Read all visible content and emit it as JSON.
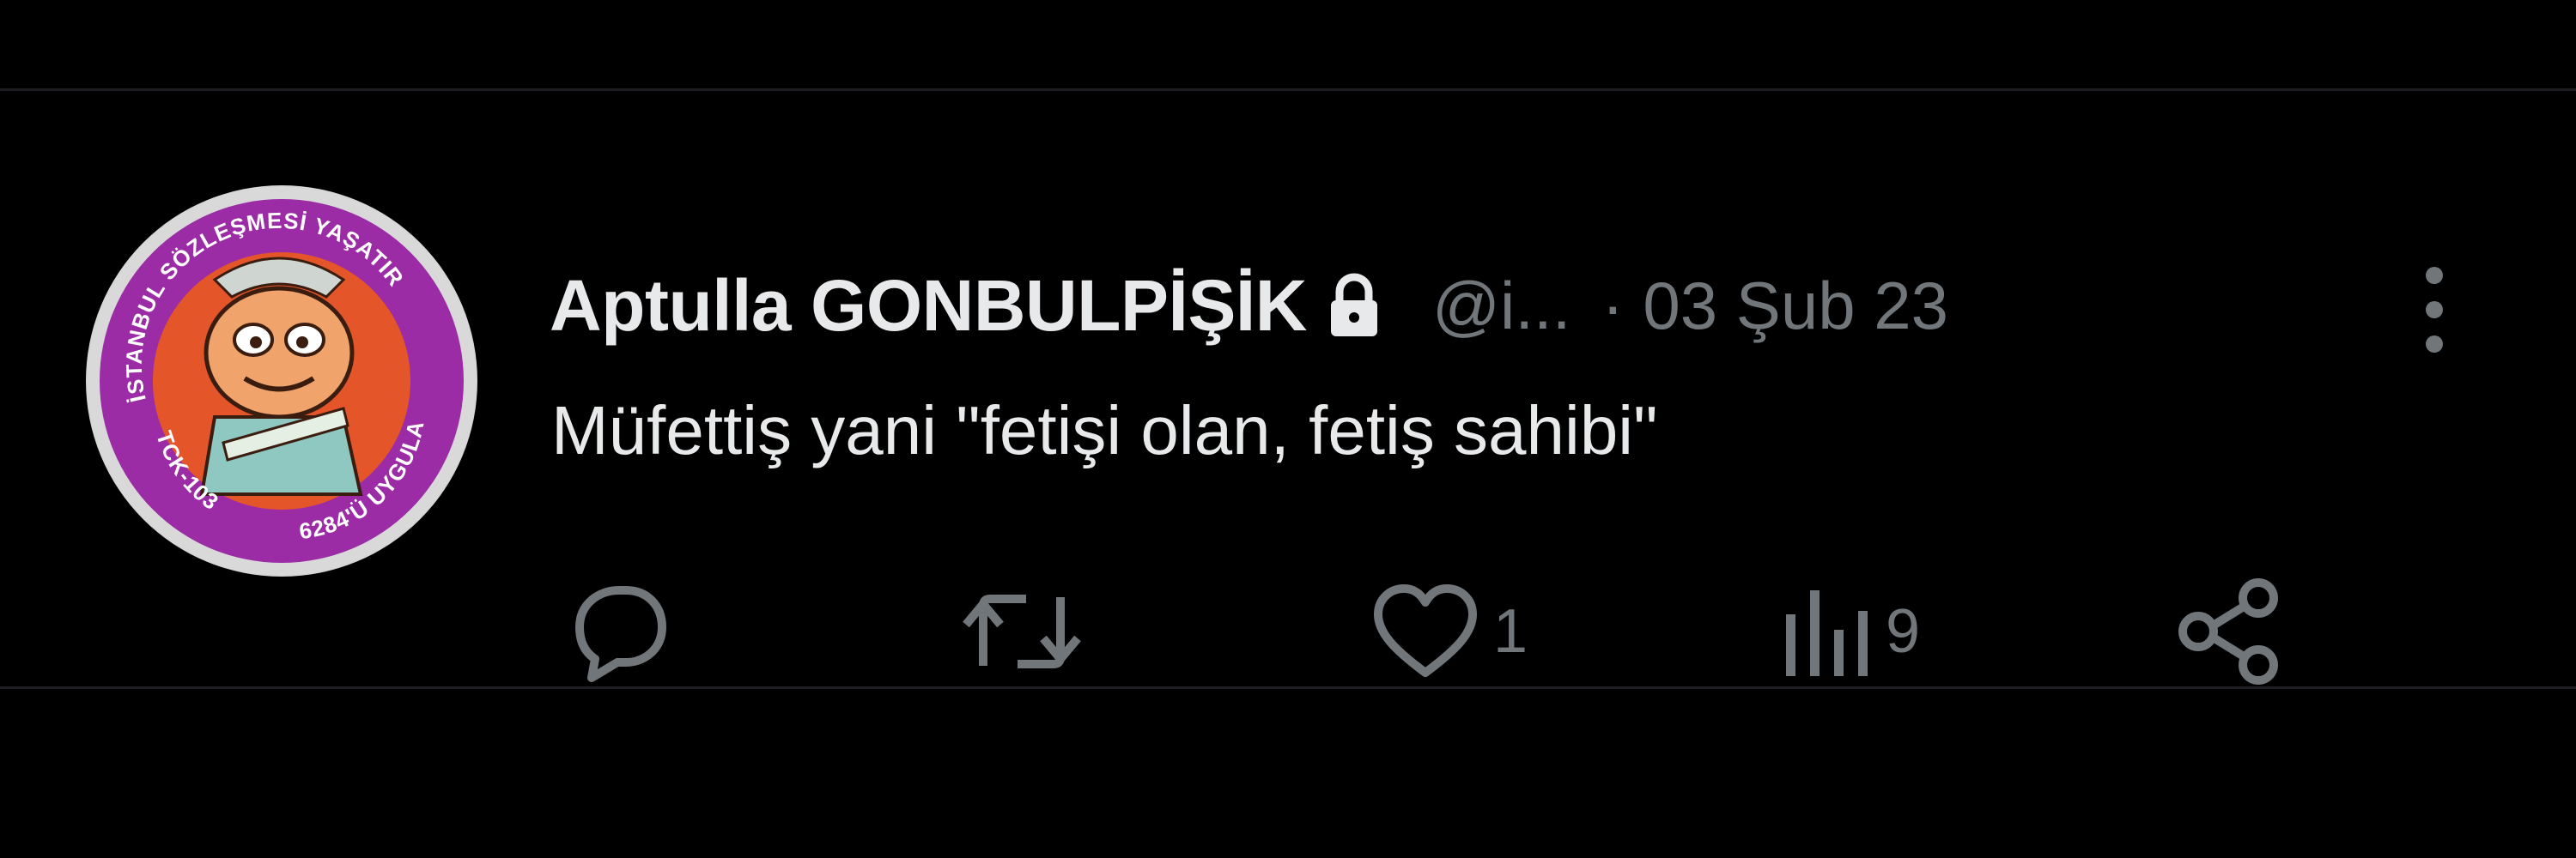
{
  "tweet": {
    "display_name": "Aptulla GONBULPİŞİK",
    "handle": "@i...",
    "separator": "·",
    "date": "03 Şub 23",
    "text": "Müfettiş yani \"fetişi olan, fetiş sahibi\"",
    "protected": true
  },
  "avatar": {
    "ring_top_text": "İSTANBUL SÖZLEŞMESİ YAŞATIR",
    "ring_left_text": "TCK-103",
    "ring_bottom_text": "6284'Ü UYGULA",
    "ring_color": "#9b2ca6",
    "inner_color": "#e4562a"
  },
  "actions": {
    "reply": {
      "icon": "reply-icon",
      "count": ""
    },
    "retweet": {
      "icon": "retweet-icon",
      "count": ""
    },
    "like": {
      "icon": "heart-icon",
      "count": "1"
    },
    "views": {
      "icon": "views-icon",
      "count": "9"
    },
    "share": {
      "icon": "share-icon",
      "count": ""
    }
  },
  "colors": {
    "background": "#000000",
    "primary_text": "#e7e9ea",
    "secondary_text": "#71767b",
    "divider": "#1c1e21"
  }
}
